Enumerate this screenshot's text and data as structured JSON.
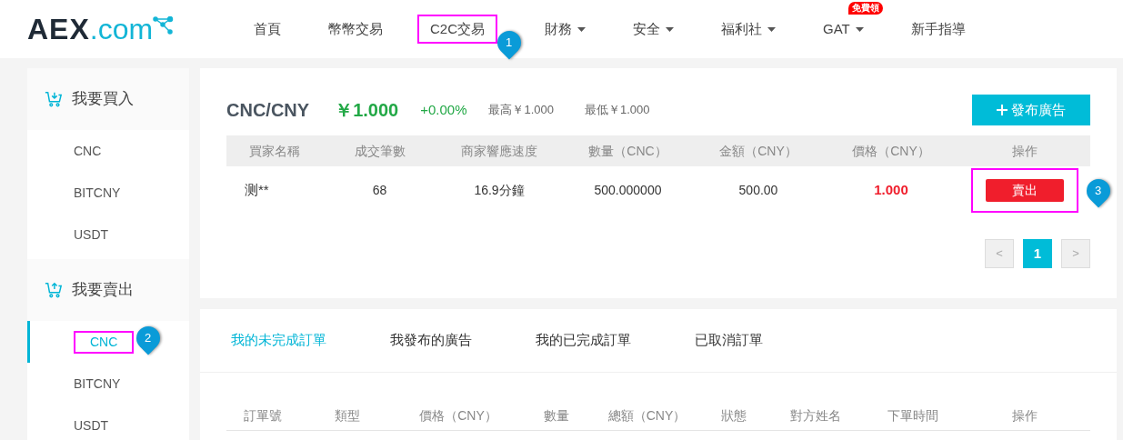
{
  "header": {
    "logo": {
      "main": "AEX",
      "suffix": ".com"
    },
    "nav": [
      {
        "label": "首頁",
        "dropdown": false,
        "highlighted": false
      },
      {
        "label": "幣幣交易",
        "dropdown": false,
        "highlighted": false
      },
      {
        "label": "C2C交易",
        "dropdown": false,
        "highlighted": true,
        "callout": "1"
      },
      {
        "label": "財務",
        "dropdown": true,
        "highlighted": false
      },
      {
        "label": "安全",
        "dropdown": true,
        "highlighted": false
      },
      {
        "label": "福利社",
        "dropdown": true,
        "highlighted": false
      },
      {
        "label": "GAT",
        "dropdown": true,
        "highlighted": false,
        "badge": "免費領"
      },
      {
        "label": "新手指導",
        "dropdown": false,
        "highlighted": false
      }
    ]
  },
  "sidebar": {
    "groups": [
      {
        "title": "我要買入",
        "kind": "buy",
        "items": [
          {
            "label": "CNC",
            "selected": false,
            "highlighted": false
          },
          {
            "label": "BITCNY",
            "selected": false,
            "highlighted": false
          },
          {
            "label": "USDT",
            "selected": false,
            "highlighted": false
          }
        ]
      },
      {
        "title": "我要賣出",
        "kind": "sell",
        "items": [
          {
            "label": "CNC",
            "selected": true,
            "highlighted": true,
            "callout": "2"
          },
          {
            "label": "BITCNY",
            "selected": false,
            "highlighted": false
          },
          {
            "label": "USDT",
            "selected": false,
            "highlighted": false
          }
        ]
      }
    ]
  },
  "market": {
    "pair": "CNC/CNY",
    "price": "￥1.000",
    "change": "+0.00%",
    "high": "最高￥1.000",
    "low": "最低￥1.000",
    "publish_button": "發布廣告"
  },
  "ads_table": {
    "columns": [
      "買家名稱",
      "成交筆數",
      "商家響應速度",
      "數量（CNC）",
      "金額（CNY）",
      "價格（CNY）",
      "操作"
    ],
    "rows": [
      {
        "cells": [
          "测**",
          "68",
          "16.9分鐘",
          "500.000000",
          "500.00",
          "1.000"
        ],
        "action": "賣出",
        "highlighted": true,
        "callout": "3"
      }
    ]
  },
  "pagination": {
    "prev": "<",
    "next": ">",
    "pages": [
      {
        "label": "1",
        "selected": true
      }
    ]
  },
  "orders": {
    "tabs": [
      {
        "label": "我的未完成訂單",
        "selected": true
      },
      {
        "label": "我發布的廣告",
        "selected": false
      },
      {
        "label": "我的已完成訂單",
        "selected": false
      },
      {
        "label": "已取消訂單",
        "selected": false
      }
    ],
    "columns": [
      "訂單號",
      "類型",
      "價格（CNY）",
      "數量",
      "總額（CNY）",
      "狀態",
      "對方姓名",
      "下單時間",
      "操作"
    ]
  }
}
